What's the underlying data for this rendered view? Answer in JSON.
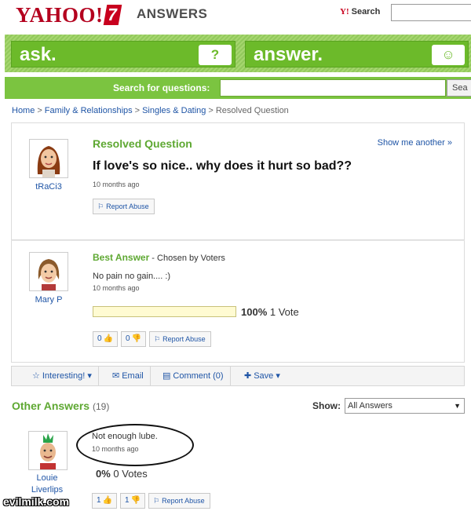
{
  "header": {
    "logo_text": "YAHOO!",
    "logo_suffix": "ANSWERS",
    "search_label": "Search"
  },
  "ask_bar": {
    "ask_label": "ask.",
    "ask_icon": "?",
    "answer_label": "answer.",
    "answer_icon": "☺"
  },
  "search_strip": {
    "label": "Search for questions:",
    "button": "Sea"
  },
  "breadcrumb": {
    "items": [
      "Home",
      "Family & Relationships",
      "Singles & Dating"
    ],
    "current": "Resolved Question"
  },
  "question": {
    "status": "Resolved Question",
    "show_another": "Show me another »",
    "title": "If love's so nice.. why does it hurt so bad??",
    "time": "10 months ago",
    "report": "Report Abuse",
    "user": "tRaCi3"
  },
  "best_answer": {
    "label": "Best Answer",
    "chosen": " - Chosen by Voters",
    "text": "No pain no gain.... :)",
    "time": "10 months ago",
    "vote_pct": "100%",
    "vote_count": "1 Vote",
    "vote_fraction": 1.0,
    "thumbs_up": "0",
    "thumbs_down": "0",
    "report": "Report Abuse",
    "user": "Mary P"
  },
  "actions": {
    "interesting": "Interesting!",
    "email": "Email",
    "comment": "Comment (0)",
    "save": "Save"
  },
  "other_answers": {
    "label": "Other Answers",
    "count": "(19)",
    "show_label": "Show:",
    "show_value": "All Answers",
    "first": {
      "text": "Not enough lube.",
      "time": "10 months ago",
      "vote_pct": "0%",
      "vote_count": "0 Votes",
      "thumbs_up": "1",
      "thumbs_down": "1",
      "report": "Report Abuse",
      "user_line1": "Louie",
      "user_line2": "Liverlips"
    }
  },
  "watermark": "evilmilk.com",
  "colors": {
    "brand_red": "#b4001e",
    "brand_green": "#6cba2a",
    "label_green": "#5ea832",
    "link_blue": "#1f55a6"
  }
}
